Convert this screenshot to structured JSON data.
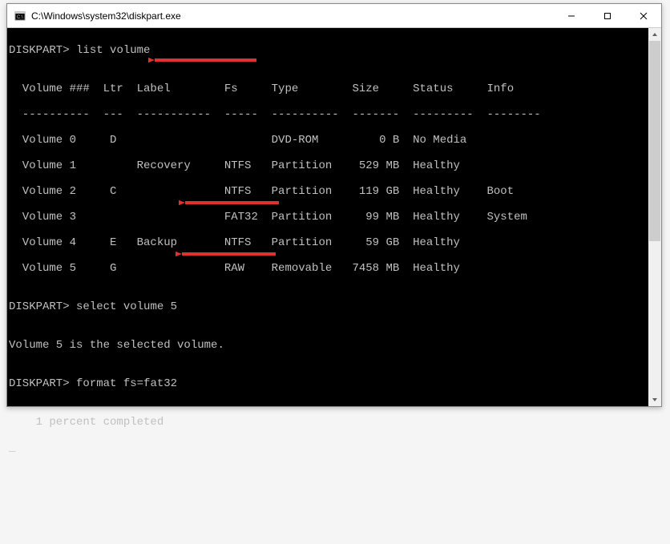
{
  "window": {
    "title": "C:\\Windows\\system32\\diskpart.exe"
  },
  "terminal": {
    "prompt": "DISKPART>",
    "cmd1": "list volume",
    "cmd2": "select volume 5",
    "cmd3": "format fs=fat32",
    "blank": "",
    "header": "  Volume ###  Ltr  Label        Fs     Type        Size     Status     Info",
    "divider": "  ----------  ---  -----------  -----  ----------  -------  ---------  --------",
    "rows": [
      "  Volume 0     D                       DVD-ROM         0 B  No Media",
      "  Volume 1         Recovery     NTFS   Partition    529 MB  Healthy",
      "  Volume 2     C                NTFS   Partition    119 GB  Healthy    Boot",
      "  Volume 3                      FAT32  Partition     99 MB  Healthy    System",
      "  Volume 4     E   Backup       NTFS   Partition     59 GB  Healthy",
      "  Volume 5     G                RAW    Removable   7458 MB  Healthy"
    ],
    "selectResponse": "Volume 5 is the selected volume.",
    "progress": "    1 percent completed",
    "cursor": "_"
  },
  "controls": {
    "min": "—",
    "max": "▢",
    "close": "✕"
  }
}
